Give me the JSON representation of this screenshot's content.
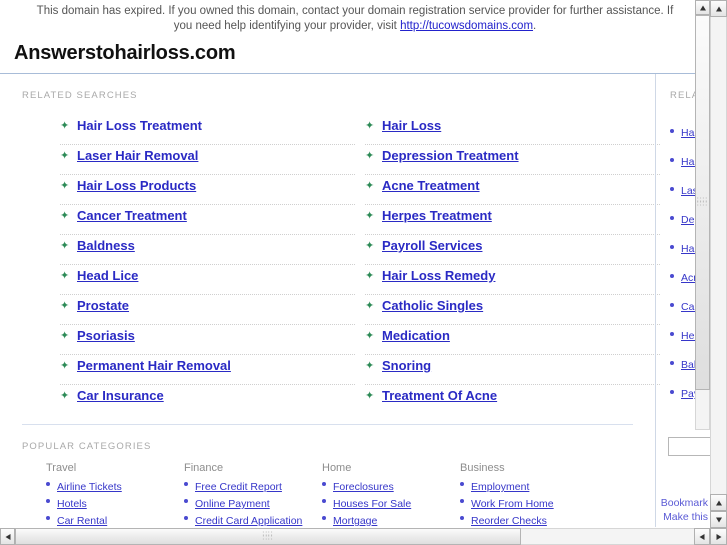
{
  "notice": {
    "text_before": "This domain has expired. If you owned this domain, contact your domain registration service provider for further assistance. If you need help identifying your provider, visit ",
    "link_text": "http://tucowsdomains.com",
    "text_after": "."
  },
  "header": {
    "domain_title": "Answerstohairloss.com"
  },
  "sections": {
    "related_searches_label": "RELATED SEARCHES",
    "popular_categories_label": "POPULAR CATEGORIES",
    "sidebar_related_label": "RELATED"
  },
  "related_searches": {
    "left_column": [
      "Hair Loss Treatment",
      "Laser Hair Removal",
      "Hair Loss Products",
      "Cancer Treatment",
      "Baldness",
      "Head Lice",
      "Prostate",
      "Psoriasis",
      "Permanent Hair Removal",
      "Car Insurance"
    ],
    "right_column": [
      "Hair Loss",
      "Depression Treatment",
      "Acne Treatment",
      "Herpes Treatment",
      "Payroll Services",
      "Hair Loss Remedy",
      "Catholic Singles",
      "Medication",
      "Snoring",
      "Treatment Of Acne"
    ]
  },
  "popular_categories": [
    {
      "heading": "Travel",
      "items": [
        "Airline Tickets",
        "Hotels",
        "Car Rental"
      ]
    },
    {
      "heading": "Finance",
      "items": [
        "Free Credit Report",
        "Online Payment",
        "Credit Card Application"
      ]
    },
    {
      "heading": "Home",
      "items": [
        "Foreclosures",
        "Houses For Sale",
        "Mortgage"
      ]
    },
    {
      "heading": "Business",
      "items": [
        "Employment",
        "Work From Home",
        "Reorder Checks"
      ]
    }
  ],
  "sidebar": {
    "items": [
      "Hair Loss Treatment",
      "Hair Loss",
      "Laser Hair Removal",
      "Depression Treatment",
      "Hair Loss Products",
      "Acne Treatment",
      "Cancer Treatment",
      "Herpes Treatment",
      "Baldness",
      "Payroll Services"
    ],
    "search_value": "",
    "search_placeholder": "",
    "footer_lines": [
      "Bookmark",
      "Make this"
    ]
  },
  "colors": {
    "link_blue": "#2a2ac4",
    "small_link_blue": "#3636c9",
    "bullet_green": "#2e8b57",
    "bullet_blue": "#4a4ad0",
    "label_gray": "#a9a9a9",
    "rule_blue": "#a8bcd8"
  },
  "icons": {
    "bullet_star": "✦",
    "scroll_up": "scroll-up-arrow-icon",
    "scroll_down": "scroll-down-arrow-icon",
    "scroll_left": "scroll-left-arrow-icon",
    "scroll_right": "scroll-right-arrow-icon"
  }
}
